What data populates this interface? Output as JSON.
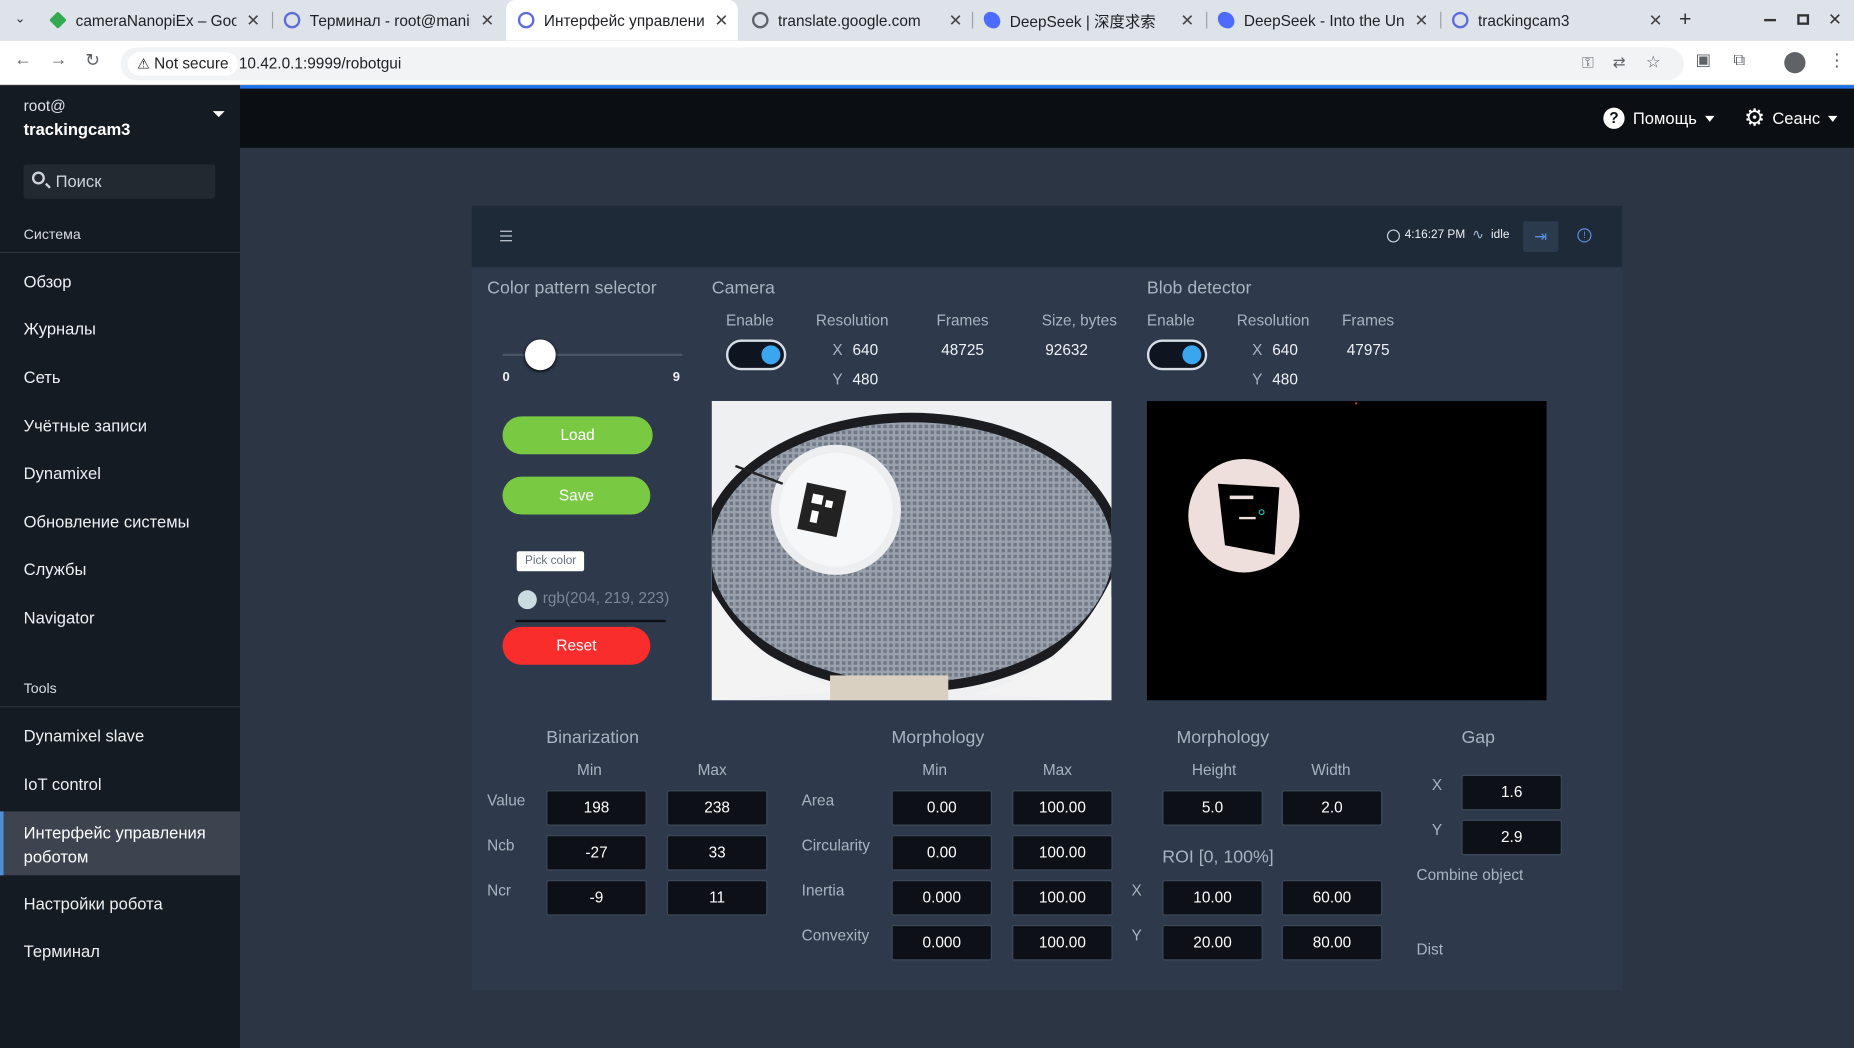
{
  "browser": {
    "tabs": [
      {
        "title": "cameraNanopiEx – Goo",
        "color": "#34a853"
      },
      {
        "title": "Терминал - root@manip",
        "color": "#5f6bd8"
      },
      {
        "title": "Интерфейс управлени",
        "color": "#5f6bd8"
      },
      {
        "title": "translate.google.com",
        "color": "#5f6368"
      },
      {
        "title": "DeepSeek | 深度求索",
        "color": "#4d6bfe"
      },
      {
        "title": "DeepSeek - Into the Unk",
        "color": "#4d6bfe"
      },
      {
        "title": "trackingcam3",
        "color": "#5f6bd8"
      }
    ],
    "not_secure": "Not secure",
    "url": "10.42.0.1:9999/robotgui"
  },
  "sidebar": {
    "user_line1": "root@",
    "user_line2": "trackingcam3",
    "search_placeholder": "Поиск",
    "section_system": "Система",
    "items": [
      "Обзор",
      "Журналы",
      "Сеть",
      "Учётные записи",
      "Dynamixel",
      "Обновление системы",
      "Службы",
      "Navigator"
    ],
    "section_tools": "Tools",
    "tool_items": [
      "Dynamixel slave",
      "IoT control",
      "Интерфейс управления роботом",
      "Настройки робота",
      "Терминал"
    ]
  },
  "header": {
    "help": "Помощь",
    "session": "Сеанс"
  },
  "panel": {
    "time": "4:16:27 PM",
    "status": "idle",
    "color_pattern": {
      "title": "Color pattern selector",
      "slider_min": "0",
      "slider_max": "9",
      "slider_value": 0.21,
      "load": "Load",
      "save": "Save",
      "pick_color": "Pick color",
      "rgb": "rgb(204, 219, 223)",
      "swatch": "#ccdbdf",
      "reset": "Reset"
    },
    "camera": {
      "title": "Camera",
      "enable_label": "Enable",
      "resolution_label": "Resolution",
      "frames_label": "Frames",
      "size_label": "Size, bytes",
      "x_label": "X",
      "y_label": "Y",
      "res_x": "640",
      "res_y": "480",
      "frames": "48725",
      "size": "92632"
    },
    "blob": {
      "title": "Blob detector",
      "enable_label": "Enable",
      "resolution_label": "Resolution",
      "frames_label": "Frames",
      "x_label": "X",
      "y_label": "Y",
      "res_x": "640",
      "res_y": "480",
      "frames": "47975"
    },
    "binarization": {
      "title": "Binarization",
      "min": "Min",
      "max": "Max",
      "rows": [
        {
          "label": "Value",
          "min": "198",
          "max": "238"
        },
        {
          "label": "Ncb",
          "min": "-27",
          "max": "33"
        },
        {
          "label": "Ncr",
          "min": "-9",
          "max": "11"
        }
      ]
    },
    "morphology1": {
      "title": "Morphology",
      "min": "Min",
      "max": "Max",
      "rows": [
        {
          "label": "Area",
          "min": "0.00",
          "max": "100.00"
        },
        {
          "label": "Circularity",
          "min": "0.00",
          "max": "100.00"
        },
        {
          "label": "Inertia",
          "min": "0.000",
          "max": "100.00"
        },
        {
          "label": "Convexity",
          "min": "0.000",
          "max": "100.00"
        }
      ]
    },
    "morphology2": {
      "title": "Morphology",
      "height_label": "Height",
      "width_label": "Width",
      "height": "5.0",
      "width": "2.0",
      "roi_title": "ROI [0, 100%]",
      "x_label": "X",
      "y_label": "Y",
      "roi_x_min": "10.00",
      "roi_x_max": "60.00",
      "roi_y_min": "20.00",
      "roi_y_max": "80.00"
    },
    "gap": {
      "title": "Gap",
      "x_label": "X",
      "y_label": "Y",
      "x": "1.6",
      "y": "2.9",
      "combine": "Combine object",
      "dist": "Dist"
    }
  }
}
